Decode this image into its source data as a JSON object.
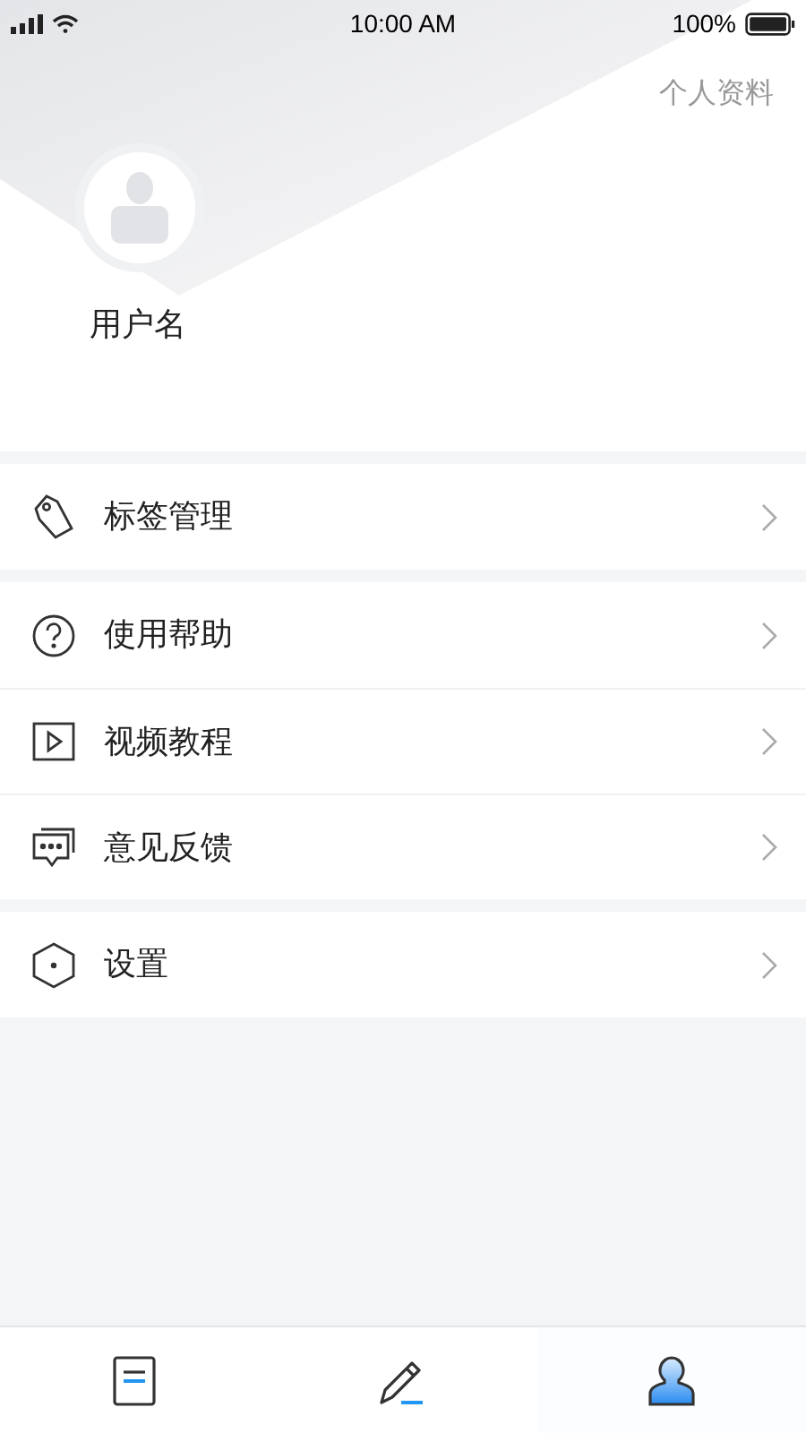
{
  "status_bar": {
    "time": "10:00 AM",
    "battery": "100%"
  },
  "header": {
    "profile_link": "个人资料",
    "username": "用户名"
  },
  "menu_groups": [
    [
      {
        "kind": "tag",
        "label": "标签管理"
      }
    ],
    [
      {
        "kind": "help",
        "label": "使用帮助"
      },
      {
        "kind": "video",
        "label": "视频教程"
      },
      {
        "kind": "feedback",
        "label": "意见反馈"
      }
    ],
    [
      {
        "kind": "settings",
        "label": "设置"
      }
    ]
  ],
  "tab_bar": [
    {
      "kind": "notes",
      "selected": false
    },
    {
      "kind": "edit",
      "selected": false
    },
    {
      "kind": "profile",
      "selected": true
    }
  ]
}
